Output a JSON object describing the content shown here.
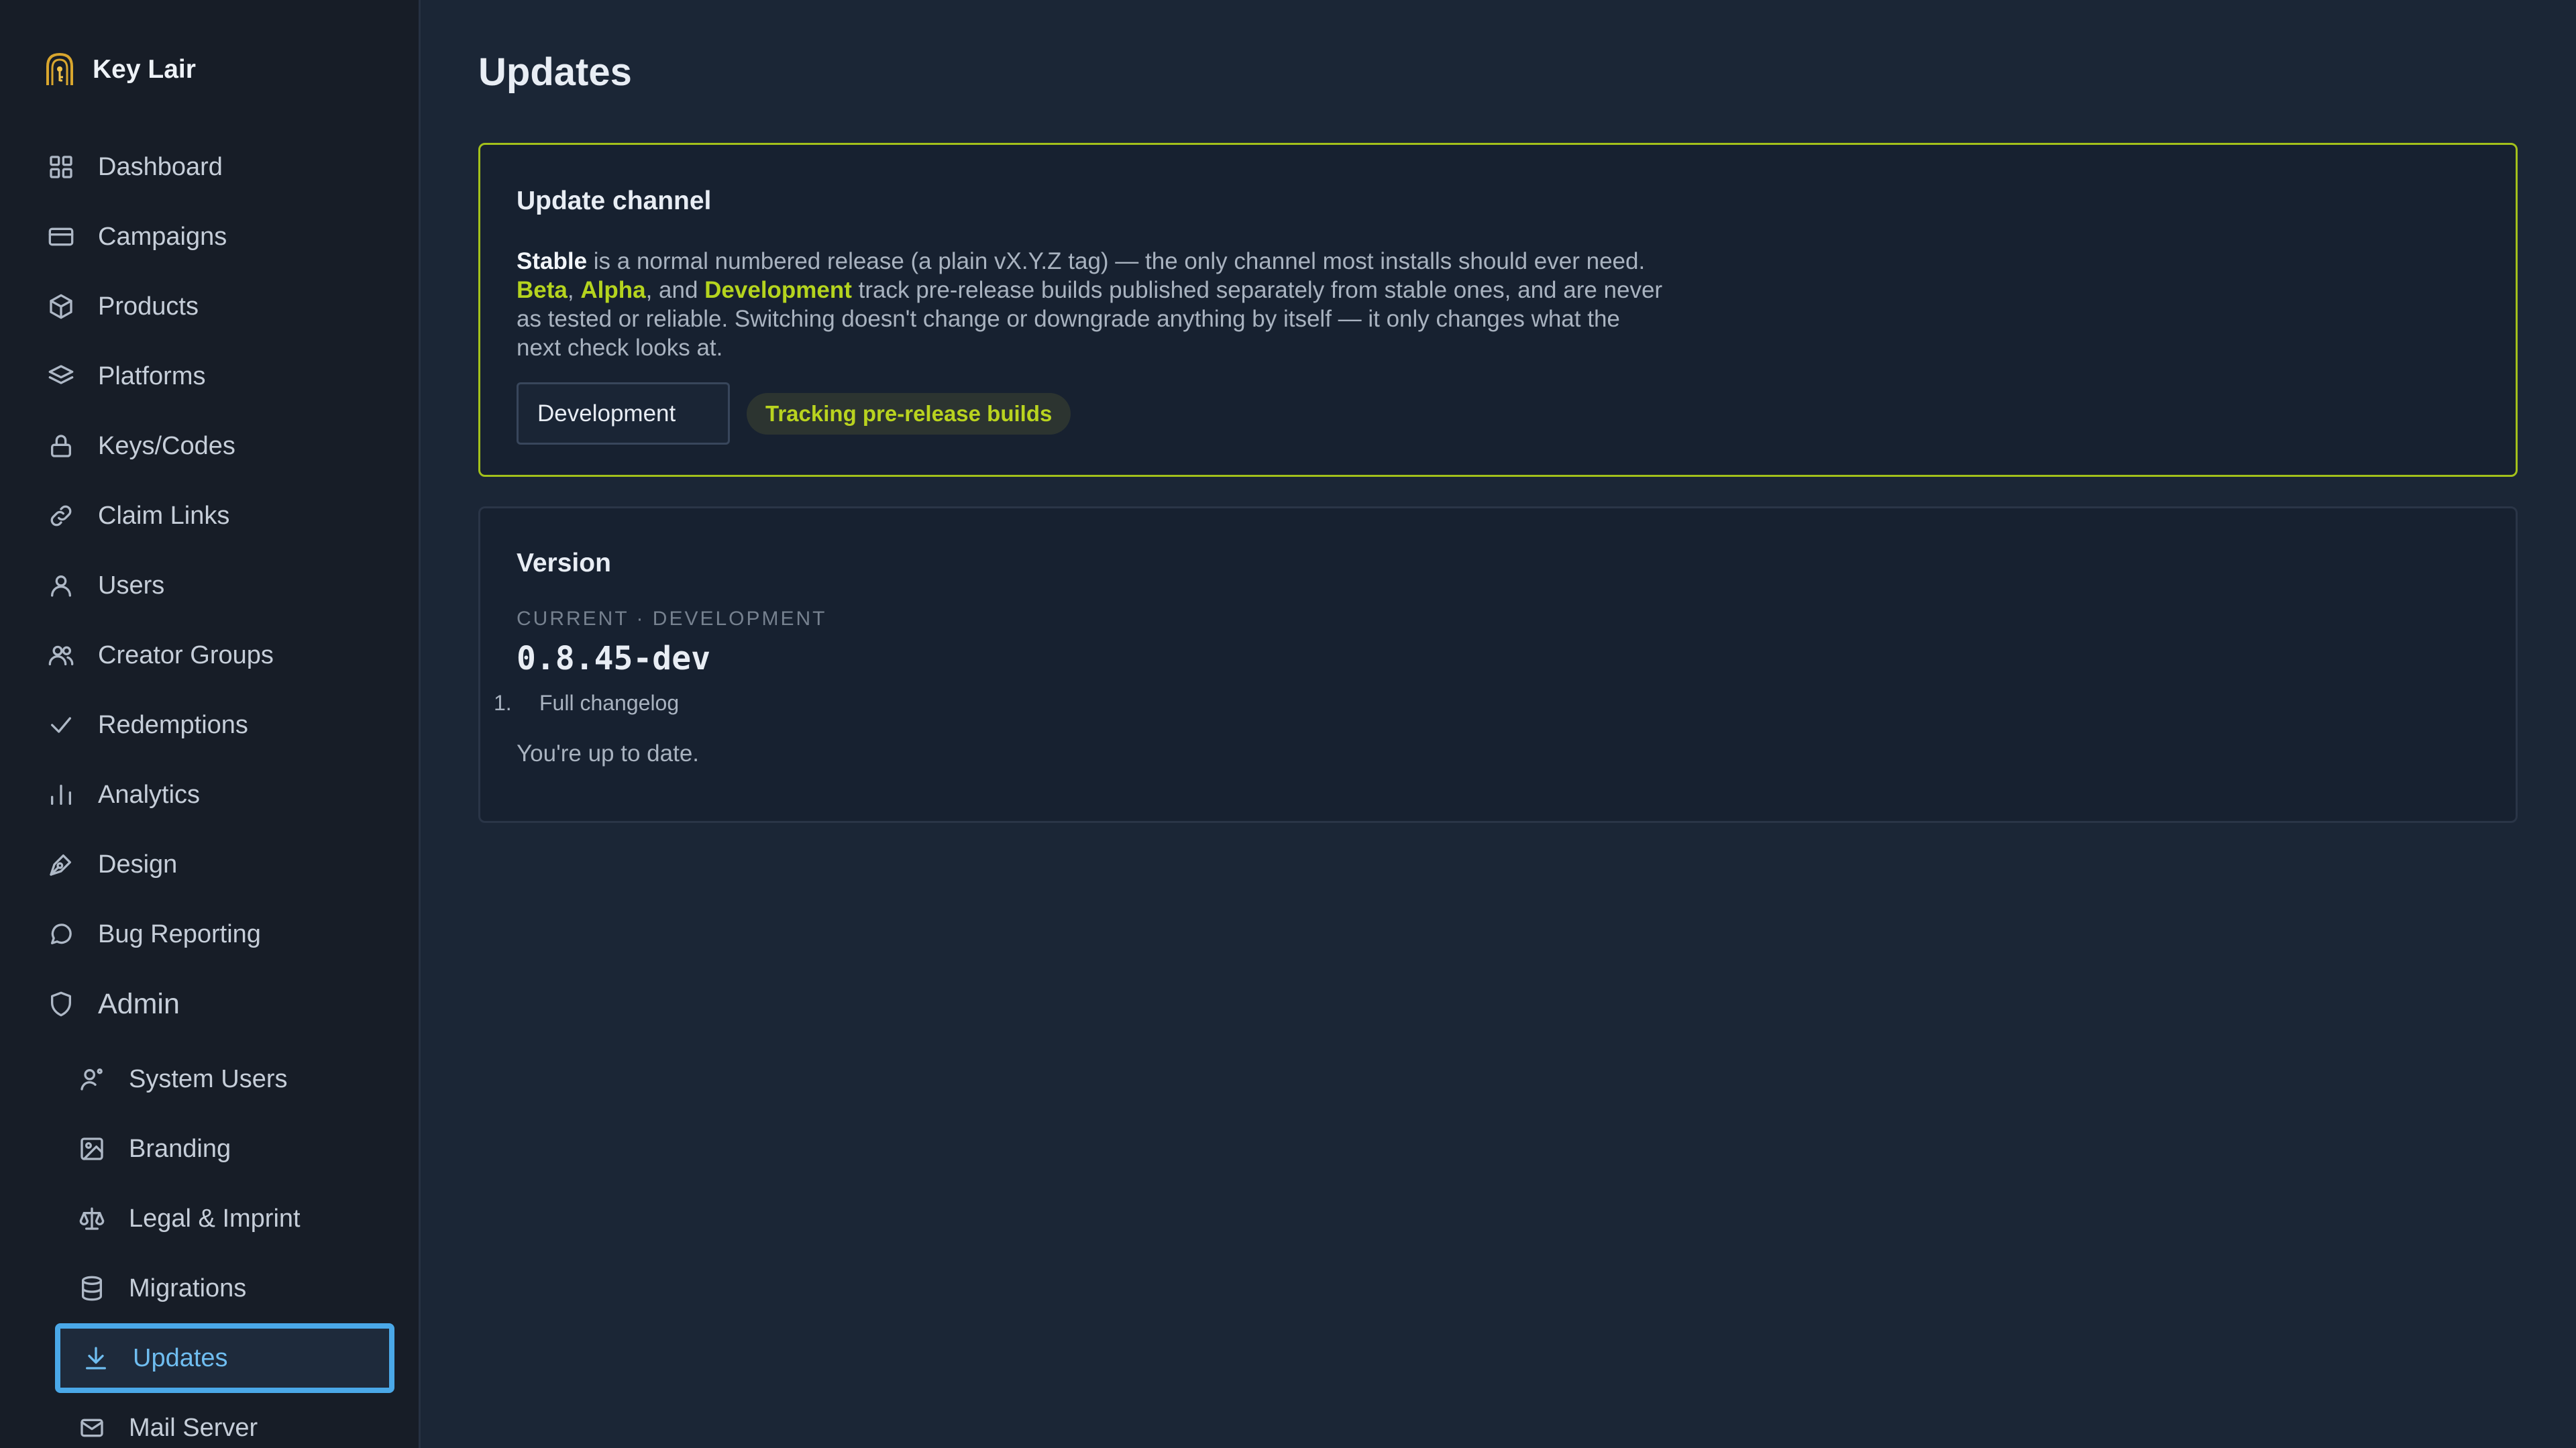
{
  "app": {
    "name": "Key Lair"
  },
  "sidebar": {
    "items": [
      {
        "label": "Dashboard",
        "icon": "dashboard-icon"
      },
      {
        "label": "Campaigns",
        "icon": "campaigns-icon"
      },
      {
        "label": "Products",
        "icon": "products-icon"
      },
      {
        "label": "Platforms",
        "icon": "platforms-icon"
      },
      {
        "label": "Keys/Codes",
        "icon": "lock-icon"
      },
      {
        "label": "Claim Links",
        "icon": "link-icon"
      },
      {
        "label": "Users",
        "icon": "user-icon"
      },
      {
        "label": "Creator Groups",
        "icon": "users-icon"
      },
      {
        "label": "Redemptions",
        "icon": "check-icon"
      },
      {
        "label": "Analytics",
        "icon": "bar-chart-icon"
      },
      {
        "label": "Design",
        "icon": "pen-tool-icon"
      },
      {
        "label": "Bug Reporting",
        "icon": "message-icon"
      }
    ],
    "admin": {
      "label": "Admin",
      "icon": "shield-icon",
      "items": [
        {
          "label": "System Users",
          "icon": "user-cog-icon"
        },
        {
          "label": "Branding",
          "icon": "image-icon"
        },
        {
          "label": "Legal & Imprint",
          "icon": "scale-icon"
        },
        {
          "label": "Migrations",
          "icon": "database-icon"
        },
        {
          "label": "Updates",
          "icon": "download-icon",
          "active": true
        },
        {
          "label": "Mail Server",
          "icon": "mail-icon"
        }
      ]
    }
  },
  "page": {
    "title": "Updates"
  },
  "channel_card": {
    "title": "Update channel",
    "desc": {
      "stable": "Stable",
      "part1": " is a normal numbered release (a plain vX.Y.Z tag) — the only channel most installs should ever need. ",
      "beta": "Beta",
      "sep1": ", ",
      "alpha": "Alpha",
      "sep2": ", and ",
      "development": "Development",
      "part2": " track pre-release builds published separately from stable ones, and are never as tested or reliable. Switching doesn't change or downgrade anything by itself — it only changes what the next check looks at."
    },
    "select_value": "Development",
    "badge": "Tracking pre-release builds"
  },
  "version_card": {
    "title": "Version",
    "current_label": "CURRENT · DEVELOPMENT",
    "version": "0.8.45-dev",
    "changelog_number": "1.",
    "changelog_link": "Full changelog",
    "status": "You're up to date."
  },
  "colors": {
    "accent": "#a3c11b",
    "active_nav": "#4aa8e8",
    "background": "#1b2636",
    "sidebar": "#171d27"
  }
}
